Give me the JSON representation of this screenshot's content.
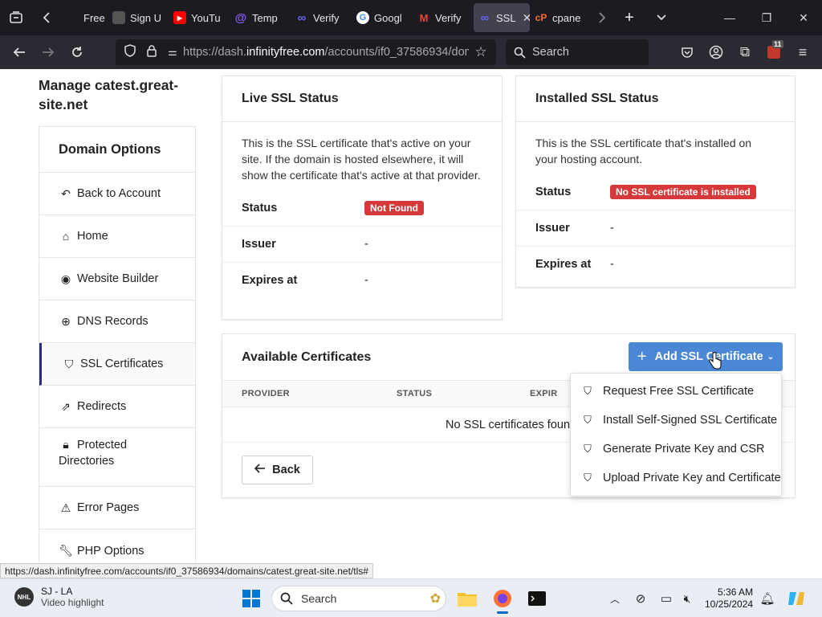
{
  "browser": {
    "tabs": [
      {
        "label": "Free v",
        "icon": "page-icon"
      },
      {
        "label": "Sign U",
        "icon": "site-icon"
      },
      {
        "label": "YouTu",
        "icon": "youtube-icon",
        "color": "#ff0000"
      },
      {
        "label": "Temp",
        "icon": "at-icon",
        "color": "#8b5cf6"
      },
      {
        "label": "Verify",
        "icon": "infinity-icon",
        "color": "#6366f1"
      },
      {
        "label": "Googl",
        "icon": "google-icon"
      },
      {
        "label": "Verify",
        "icon": "gmail-icon"
      },
      {
        "label": "SSL",
        "icon": "infinity-icon",
        "color": "#6366f1",
        "active": true
      },
      {
        "label": "cpane",
        "icon": "cpanel-icon",
        "color": "#ff6c2c"
      }
    ],
    "url_prefix": "https://dash.",
    "url_domain": "infinityfree.com",
    "url_rest": "/accounts/if0_37586934/dom",
    "search_placeholder": "Search",
    "notification_count": "11"
  },
  "page": {
    "heading": "Manage catest.great-site.net",
    "sidebar": {
      "title": "Domain Options",
      "items": [
        {
          "label": "Back to Account",
          "icon": "undo-icon"
        },
        {
          "label": "Home",
          "icon": "home-icon"
        },
        {
          "label": "Website Builder",
          "icon": "palette-icon"
        },
        {
          "label": "DNS Records",
          "icon": "globe-icon"
        },
        {
          "label": "SSL Certificates",
          "icon": "shield-icon",
          "active": true
        },
        {
          "label": "Redirects",
          "icon": "external-link-icon"
        },
        {
          "label": "Protected Directories",
          "icon": "lock-icon"
        },
        {
          "label": "Error Pages",
          "icon": "warning-icon"
        },
        {
          "label": "PHP Options",
          "icon": "wrench-icon"
        }
      ]
    },
    "live_ssl": {
      "title": "Live SSL Status",
      "description": "This is the SSL certificate that's active on your site. If the domain is hosted elsewhere, it will show the certificate that's active at that provider.",
      "status_label": "Status",
      "status_value": "Not Found",
      "issuer_label": "Issuer",
      "issuer_value": "-",
      "expires_label": "Expires at",
      "expires_value": "-"
    },
    "installed_ssl": {
      "title": "Installed SSL Status",
      "description": "This is the SSL certificate that's installed on your hosting account.",
      "status_label": "Status",
      "status_value": "No SSL certificate is installed",
      "issuer_label": "Issuer",
      "issuer_value": "-",
      "expires_label": "Expires at",
      "expires_value": "-"
    },
    "available": {
      "title": "Available Certificates",
      "add_button": "Add SSL Certificate",
      "columns": [
        "PROVIDER",
        "STATUS",
        "EXPIR"
      ],
      "empty_text": "No SSL certificates found",
      "back_button": "Back",
      "menu": [
        "Request Free SSL Certificate",
        "Install Self-Signed SSL Certificate",
        "Generate Private Key and CSR",
        "Upload Private Key and Certificate"
      ]
    },
    "status_url": "https://dash.infinityfree.com/accounts/if0_37586934/domains/catest.great-site.net/tls#"
  },
  "taskbar": {
    "news_title": "SJ - LA",
    "news_subtitle": "Video highlight",
    "search_placeholder": "Search",
    "time": "5:36 AM",
    "date": "10/25/2024"
  },
  "colors": {
    "badge_red": "#d63939",
    "button_blue": "#4a87d5",
    "active_accent": "#2a2d7c"
  }
}
